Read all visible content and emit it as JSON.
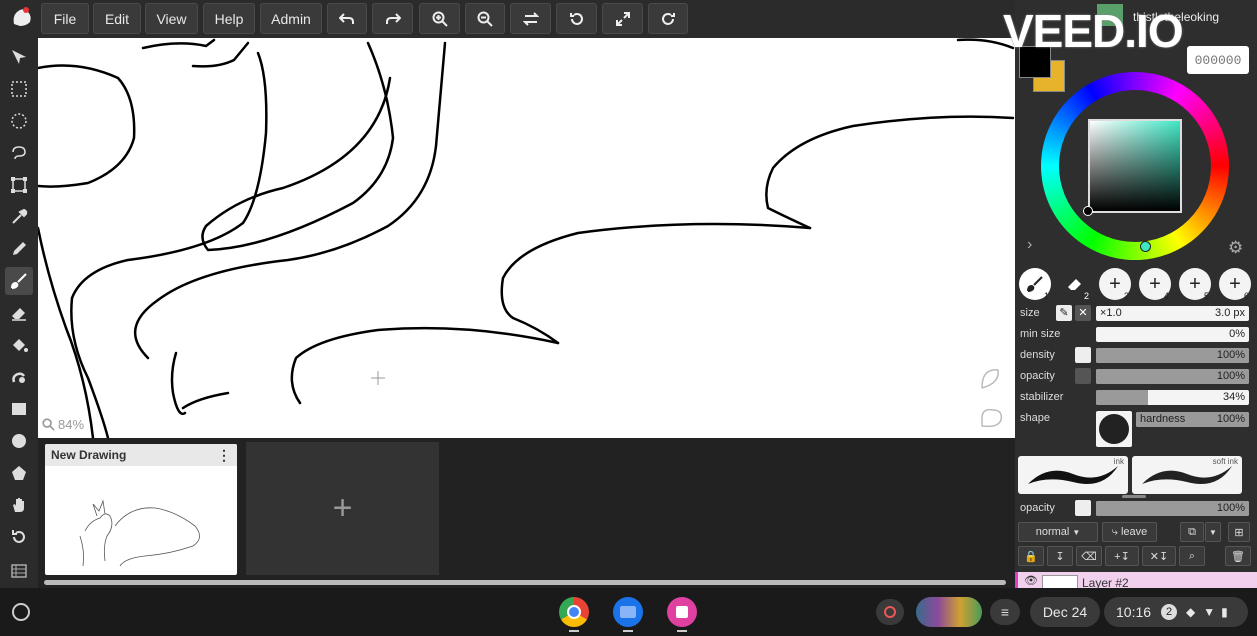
{
  "menu": {
    "items": [
      "File",
      "Edit",
      "View",
      "Help",
      "Admin"
    ]
  },
  "canvas": {
    "zoom_label": "84%"
  },
  "documents": {
    "card_title": "New Drawing",
    "add_label": "+"
  },
  "user": {
    "name": "thistletheleoking"
  },
  "color": {
    "hex": "000000",
    "primary": "#000000",
    "secondary": "#e6b32a",
    "wheel_inner": "#4fe0c0"
  },
  "brush_slots": [
    {
      "icon": "brush-icon",
      "num": "1"
    },
    {
      "icon": "eraser-icon",
      "num": "2"
    },
    {
      "icon": "plus-icon",
      "num": "3"
    },
    {
      "icon": "plus-icon",
      "num": "4"
    },
    {
      "icon": "plus-icon",
      "num": "5"
    },
    {
      "icon": "plus-icon",
      "num": "6"
    }
  ],
  "brush": {
    "size_label": "size",
    "size_multiplier": "×1.0",
    "size_value": "3.0 px",
    "min_size_label": "min size",
    "min_size_value": "0%",
    "density_label": "density",
    "density_value": "100%",
    "opacity_label": "opacity",
    "opacity_value": "100%",
    "stabilizer_label": "stabilizer",
    "stabilizer_value": "34%",
    "stabilizer_fraction": 0.34,
    "shape_label": "shape",
    "hardness_label": "hardness",
    "hardness_value": "100%",
    "tile_ink": "ink",
    "tile_soft_ink": "soft ink"
  },
  "layer": {
    "opacity_label": "opacity",
    "opacity_value": "100%",
    "blend_mode": "normal",
    "leave_label": "leave",
    "first_layer_name": "Layer #2"
  },
  "taskbar": {
    "date": "Dec 24",
    "time": "10:16",
    "notification_count": "2"
  },
  "watermark": "VEED.IO"
}
